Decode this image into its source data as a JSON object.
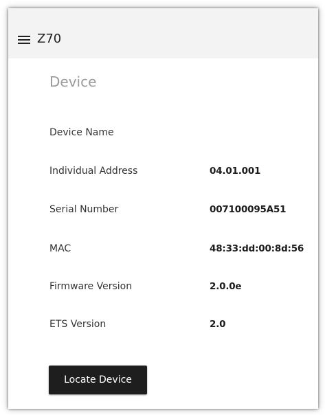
{
  "app": {
    "title": "Z70"
  },
  "section": {
    "title": "Device"
  },
  "rows": [
    {
      "label": "Device Name",
      "value": ""
    },
    {
      "label": "Individual Address",
      "value": "04.01.001"
    },
    {
      "label": "Serial Number",
      "value": "007100095A51"
    },
    {
      "label": "MAC",
      "value": "48:33:dd:00:8d:56"
    },
    {
      "label": "Firmware Version",
      "value": "2.0.0e"
    },
    {
      "label": "ETS Version",
      "value": "2.0"
    }
  ],
  "actions": {
    "locate_label": "Locate Device"
  },
  "icons": {
    "menu": "hamburger-menu-icon"
  },
  "colors": {
    "appbar_bg": "#f3f3f3",
    "button_bg": "#1e1e1e",
    "section_title": "#9a9a9a"
  }
}
